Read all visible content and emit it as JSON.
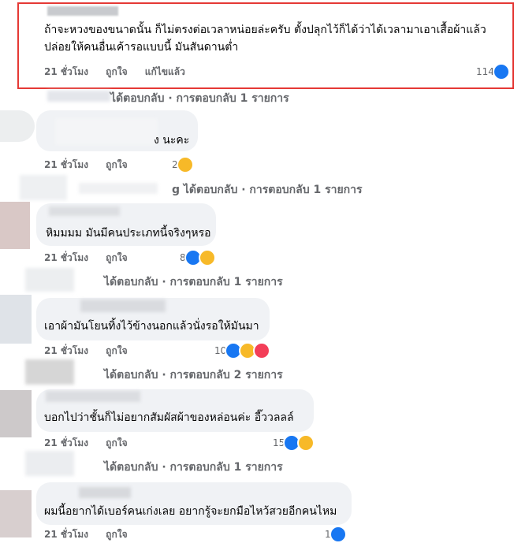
{
  "comments": [
    {
      "text_lines": [
        "ถ้าจะหวงของขนาดนั้น ก็ไม่ตรงต่อเวลาหน่อยล่ะครับ ตั้งปลุกไว้ก็ได้ว่าได้เวลามาเอาเสื้อผ้าแล้ว",
        "ปล่อยให้คนอื่นเค้ารอแบบนี้ มันสันดานต่ำ"
      ],
      "time": "21 ชั่วโมง",
      "like": "ถูกใจ",
      "edited": "แก้ไขแล้ว",
      "reactions": "114",
      "reply_summary": "ได้ตอบกลับ · การตอบกลับ 1 รายการ"
    },
    {
      "text_lines": [
        "ง นะคะ"
      ],
      "time": "21 ชั่วโมง",
      "like": "ถูกใจ",
      "reactions": "2",
      "reply_summary": "g ได้ตอบกลับ · การตอบกลับ 1 รายการ"
    },
    {
      "text_lines": [
        "หิมมมม มันมีคนประเภทนี้จริงๆหรอ"
      ],
      "time": "21 ชั่วโมง",
      "like": "ถูกใจ",
      "reactions": "8",
      "reply_summary": "ได้ตอบกลับ · การตอบกลับ 1 รายการ"
    },
    {
      "text_lines": [
        "เอาผ้ามันโยนทิ้งไว้ข้างนอกแล้วนั่งรอให้มันมา"
      ],
      "time": "21 ชั่วโมง",
      "like": "ถูกใจ",
      "reactions": "10",
      "reply_summary": "ได้ตอบกลับ · การตอบกลับ 2 รายการ"
    },
    {
      "text_lines": [
        "บอกไปว่าชั้นก็ไม่อยากสัมผัสผ้าของหล่อนค่ะ อี๊ววลลล์"
      ],
      "time": "21 ชั่วโมง",
      "like": "ถูกใจ",
      "reactions": "15",
      "reply_summary": "ได้ตอบกลับ · การตอบกลับ 1 รายการ"
    },
    {
      "text_lines": [
        "ผมนี้อยากได้เบอร์คนเก่งเลย อยากรู้จะยกมือไหว้สวยอีกคนไหม"
      ],
      "time": "21 ชั่วโมง",
      "like": "ถูกใจ",
      "reactions": "1"
    }
  ],
  "colors": {
    "like": "#1877f2",
    "haha": "#f7b928",
    "love": "#f33e58",
    "highlight": "#e53935",
    "bubble": "#f0f2f5",
    "meta": "#65676b"
  },
  "icons": {
    "like": "like-reaction-icon",
    "haha": "haha-reaction-icon",
    "love": "love-reaction-icon"
  }
}
